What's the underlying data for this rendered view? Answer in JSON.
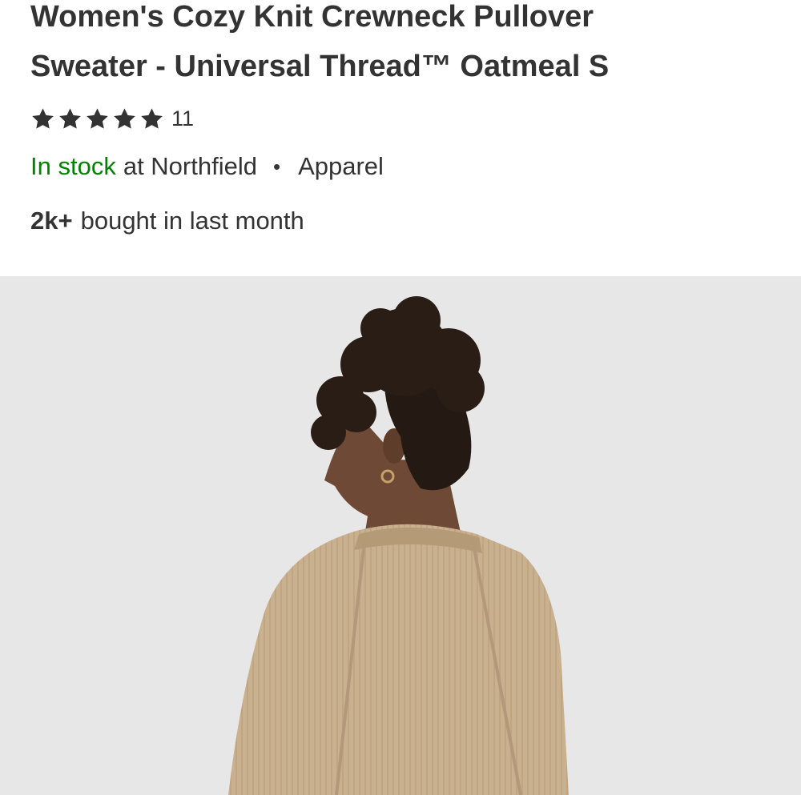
{
  "product": {
    "title_line1": "Women's Cozy Knit Crewneck Pullover",
    "title_line2": "Sweater - Universal Thread™ Oatmeal S",
    "rating": {
      "stars": 5,
      "count": "11"
    },
    "availability": {
      "status": "In stock",
      "store_text": "at Northfield",
      "separator": "•",
      "category": "Apparel"
    },
    "popularity": {
      "count": "2k+",
      "text": "bought in last month"
    },
    "image_alt": "Model wearing oatmeal knit crewneck pullover sweater, back view"
  },
  "colors": {
    "text": "#333333",
    "in_stock_green": "#008300",
    "image_background": "#e7e7e7",
    "sweater": "#c9b08e",
    "hair": "#2a1d15",
    "skin": "#6e4a36"
  },
  "icons": {
    "star": "star-filled-icon"
  }
}
